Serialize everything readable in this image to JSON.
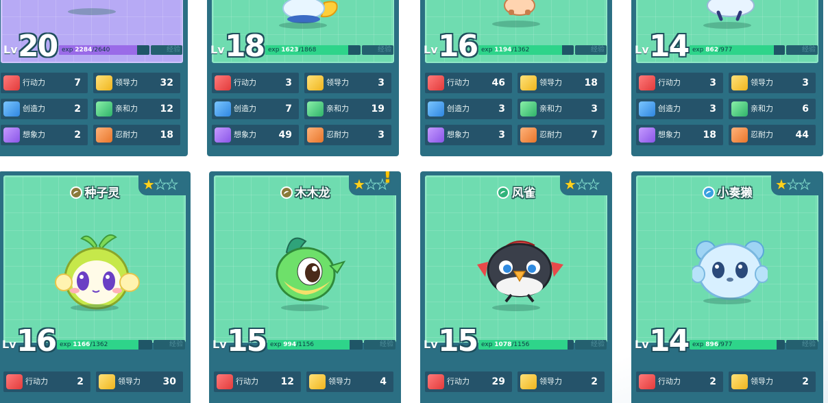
{
  "ui": {
    "exp_label": "exp",
    "exp_button": "经验"
  },
  "top_cards": [
    {
      "level": "20",
      "exp_current": "2284",
      "exp_max": "/2640",
      "exp_ratio": 0.865,
      "theme": "purple",
      "stats": [
        {
          "label": "行动力",
          "value": "7",
          "icon": "action-icon"
        },
        {
          "label": "领导力",
          "value": "32",
          "icon": "leadership-icon"
        },
        {
          "label": "创造力",
          "value": "2",
          "icon": "creativity-icon"
        },
        {
          "label": "亲和力",
          "value": "12",
          "icon": "affinity-icon"
        },
        {
          "label": "想象力",
          "value": "2",
          "icon": "imagination-icon"
        },
        {
          "label": "忍耐力",
          "value": "18",
          "icon": "endurance-icon"
        }
      ]
    },
    {
      "level": "18",
      "exp_current": "1623",
      "exp_max": "/1868",
      "exp_ratio": 0.869,
      "theme": "green",
      "stats": [
        {
          "label": "行动力",
          "value": "3",
          "icon": "action-icon"
        },
        {
          "label": "领导力",
          "value": "3",
          "icon": "leadership-icon"
        },
        {
          "label": "创造力",
          "value": "7",
          "icon": "creativity-icon"
        },
        {
          "label": "亲和力",
          "value": "19",
          "icon": "affinity-icon"
        },
        {
          "label": "想象力",
          "value": "49",
          "icon": "imagination-icon"
        },
        {
          "label": "忍耐力",
          "value": "3",
          "icon": "endurance-icon"
        }
      ]
    },
    {
      "level": "16",
      "exp_current": "1194",
      "exp_max": "/1362",
      "exp_ratio": 0.877,
      "theme": "green",
      "stats": [
        {
          "label": "行动力",
          "value": "46",
          "icon": "action-icon"
        },
        {
          "label": "领导力",
          "value": "18",
          "icon": "leadership-icon"
        },
        {
          "label": "创造力",
          "value": "3",
          "icon": "creativity-icon"
        },
        {
          "label": "亲和力",
          "value": "3",
          "icon": "affinity-icon"
        },
        {
          "label": "想象力",
          "value": "3",
          "icon": "imagination-icon"
        },
        {
          "label": "忍耐力",
          "value": "7",
          "icon": "endurance-icon"
        }
      ]
    },
    {
      "level": "14",
      "exp_current": "862",
      "exp_max": "/977",
      "exp_ratio": 0.882,
      "theme": "green",
      "stats": [
        {
          "label": "行动力",
          "value": "3",
          "icon": "action-icon"
        },
        {
          "label": "领导力",
          "value": "3",
          "icon": "leadership-icon"
        },
        {
          "label": "创造力",
          "value": "3",
          "icon": "creativity-icon"
        },
        {
          "label": "亲和力",
          "value": "6",
          "icon": "affinity-icon"
        },
        {
          "label": "想象力",
          "value": "18",
          "icon": "imagination-icon"
        },
        {
          "label": "忍耐力",
          "value": "44",
          "icon": "endurance-icon"
        }
      ]
    }
  ],
  "bottom_cards": [
    {
      "name": "种子灵",
      "type_icon": "grass-type-icon",
      "stars": 1,
      "max_stars": 3,
      "level": "16",
      "exp_current": "1166",
      "exp_max": "/1362",
      "exp_ratio": 0.856,
      "stats": [
        {
          "label": "行动力",
          "value": "2",
          "icon": "action-icon"
        },
        {
          "label": "领导力",
          "value": "30",
          "icon": "leadership-icon"
        }
      ]
    },
    {
      "name": "木木龙",
      "type_icon": "grass-type-icon",
      "stars": 1,
      "max_stars": 3,
      "alert": "!",
      "level": "15",
      "exp_current": "994",
      "exp_max": "/1156",
      "exp_ratio": 0.86,
      "stats": [
        {
          "label": "行动力",
          "value": "12",
          "icon": "action-icon"
        },
        {
          "label": "领导力",
          "value": "4",
          "icon": "leadership-icon"
        }
      ]
    },
    {
      "name": "风雀",
      "type_icon": "wind-type-icon",
      "stars": 1,
      "max_stars": 3,
      "level": "15",
      "exp_current": "1078",
      "exp_max": "/1156",
      "exp_ratio": 0.932,
      "stats": [
        {
          "label": "行动力",
          "value": "29",
          "icon": "action-icon"
        },
        {
          "label": "领导力",
          "value": "2",
          "icon": "leadership-icon"
        }
      ]
    },
    {
      "name": "小奏獭",
      "type_icon": "water-type-icon",
      "stars": 1,
      "max_stars": 3,
      "level": "14",
      "exp_current": "896",
      "exp_max": "/977",
      "exp_ratio": 0.917,
      "stats": [
        {
          "label": "行动力",
          "value": "2",
          "icon": "action-icon"
        },
        {
          "label": "领导力",
          "value": "2",
          "icon": "leadership-icon"
        }
      ]
    }
  ]
}
